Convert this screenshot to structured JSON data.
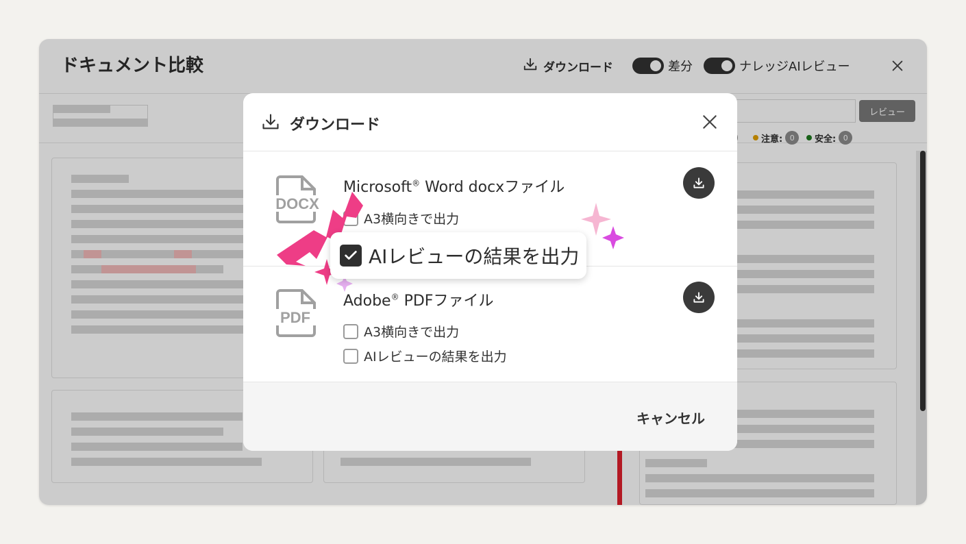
{
  "app": {
    "title": "ドキュメント比較",
    "download_label": "ダウンロード",
    "diff_label": "差分",
    "knowledge_label": "ナレッジAIレビュー",
    "review_button": "レビュー",
    "legend": [
      {
        "label": "注意:",
        "count": "0",
        "color": "#e3a000"
      },
      {
        "label": "安全:",
        "count": "0",
        "color": "#1f7a1f"
      }
    ],
    "hidden_count": "0"
  },
  "modal": {
    "title": "ダウンロード",
    "options": [
      {
        "icon_label": "DOCX",
        "name": "Microsoft",
        "reg": "®",
        "name_rest": " Word docxファイル",
        "checkbox_a3": "A3横向きで出力",
        "checkbox_ai": "AIレビューの結果を出力"
      },
      {
        "icon_label": "PDF",
        "name": "Adobe",
        "reg": "®",
        "name_rest": " PDFファイル",
        "checkbox_a3": "A3横向きで出力",
        "checkbox_ai": "AIレビューの結果を出力"
      }
    ],
    "cancel_label": "キャンセル"
  },
  "callout": {
    "label": "AIレビューの結果を出力",
    "checked": true
  },
  "colors": {
    "accent_pink": "#ee3d86",
    "sparkle_magenta": "#d94be0",
    "sparkle_light_pink": "#f6b6d2",
    "sparkle_lavender": "#e6b0f0",
    "status_red": "#e0202c"
  }
}
